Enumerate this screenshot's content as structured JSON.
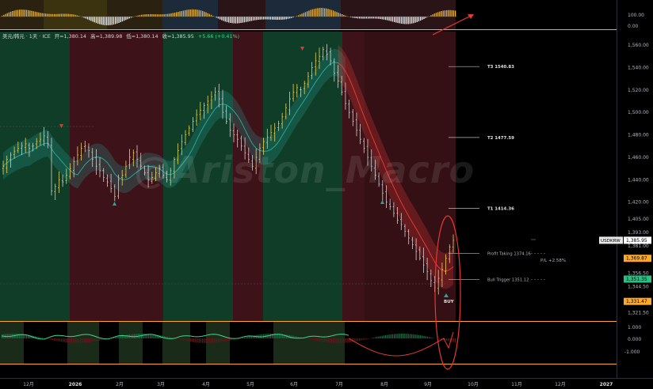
{
  "header": {
    "symbol": "美元/韩元 · 1天 · ICE",
    "open_label": "开=1,380.14",
    "high_label": "高=1,389.98",
    "low_label": "低=1,380.14",
    "close_label": "收=1,385.95",
    "change_label": "+5.66 (+0.41%)"
  },
  "watermark": "@Ariston_Macro",
  "colors": {
    "bull_band": "#0f3d27",
    "bear_band": "#3d1218",
    "price_up": "#e8d25a",
    "price_down": "#d0d0d0",
    "orange_border": "#ffa726",
    "red_arrow": "#e53935",
    "green": "#26a69a",
    "axis_text": "#b2b5be"
  },
  "chart_data": {
    "type": "candlestick",
    "symbol": "USDKRW",
    "last_price": "1,385.95",
    "y_axis": {
      "ylim": [
        1314,
        1572
      ],
      "ticks": [
        "1,560.00",
        "1,540.00",
        "1,520.00",
        "1,500.00",
        "1,480.00",
        "1,460.00",
        "1,440.00",
        "1,420.00",
        "1,405.00",
        "1,393.00",
        "1,381.00",
        "1,369.87",
        "1,356.50",
        "1,351.35",
        "1,344.50",
        "1,331.47",
        "1,321.50"
      ]
    },
    "x_axis": {
      "labels": [
        "12月",
        "2026",
        "2月",
        "3月",
        "4月",
        "5月",
        "6月",
        "7月",
        "8月",
        "9月",
        "10月",
        "11月",
        "12月",
        "2027"
      ]
    },
    "price_tags": [
      {
        "label": "USDKRW",
        "value": "1,385.95",
        "style": "white"
      },
      {
        "value": "1,369.87",
        "style": "orange"
      },
      {
        "value": "1,351.35",
        "style": "green"
      },
      {
        "value": "1,331.47",
        "style": "orange"
      }
    ],
    "levels": [
      {
        "name": "T3",
        "label": "T3 1540.83",
        "value": 1540.83
      },
      {
        "name": "T2",
        "label": "T2 1477.59",
        "value": 1477.59
      },
      {
        "name": "T1",
        "label": "T1 1414.36",
        "value": 1414.36
      },
      {
        "name": "profit",
        "label": "Profit Taking 1374.16",
        "value": 1374.16
      },
      {
        "name": "bull",
        "label": "Bull Trigger 1351.12",
        "value": 1351.12
      }
    ],
    "pl_label": "P/L +2.58%",
    "buy_label": "BUY",
    "top_panel": {
      "ticks": [
        "100.00",
        "0.00"
      ]
    },
    "bottom_panel": {
      "ticks": [
        "1.000",
        "0.000",
        "-1.000"
      ]
    },
    "closes": [
      1452,
      1458,
      1462,
      1465,
      1468,
      1470,
      1472,
      1468,
      1470,
      1474,
      1476,
      1479,
      1472,
      1430,
      1434,
      1440,
      1438,
      1444,
      1450,
      1456,
      1462,
      1468,
      1470,
      1466,
      1458,
      1452,
      1448,
      1442,
      1438,
      1432,
      1425,
      1440,
      1444,
      1452,
      1460,
      1464,
      1458,
      1452,
      1446,
      1440,
      1442,
      1446,
      1450,
      1444,
      1440,
      1448,
      1458,
      1466,
      1474,
      1480,
      1486,
      1492,
      1498,
      1502,
      1506,
      1510,
      1514,
      1518,
      1512,
      1500,
      1492,
      1484,
      1480,
      1476,
      1470,
      1464,
      1458,
      1452,
      1460,
      1468,
      1474,
      1478,
      1482,
      1486,
      1490,
      1496,
      1504,
      1512,
      1518,
      1522,
      1520,
      1526,
      1532,
      1540,
      1546,
      1550,
      1556,
      1552,
      1546,
      1535,
      1528,
      1518,
      1508,
      1500,
      1492,
      1484,
      1476,
      1468,
      1460,
      1452,
      1444,
      1436,
      1428,
      1420,
      1416,
      1410,
      1404,
      1400,
      1394,
      1388,
      1382,
      1376,
      1370,
      1364,
      1358,
      1350,
      1344,
      1352,
      1360,
      1370,
      1380,
      1386
    ]
  }
}
